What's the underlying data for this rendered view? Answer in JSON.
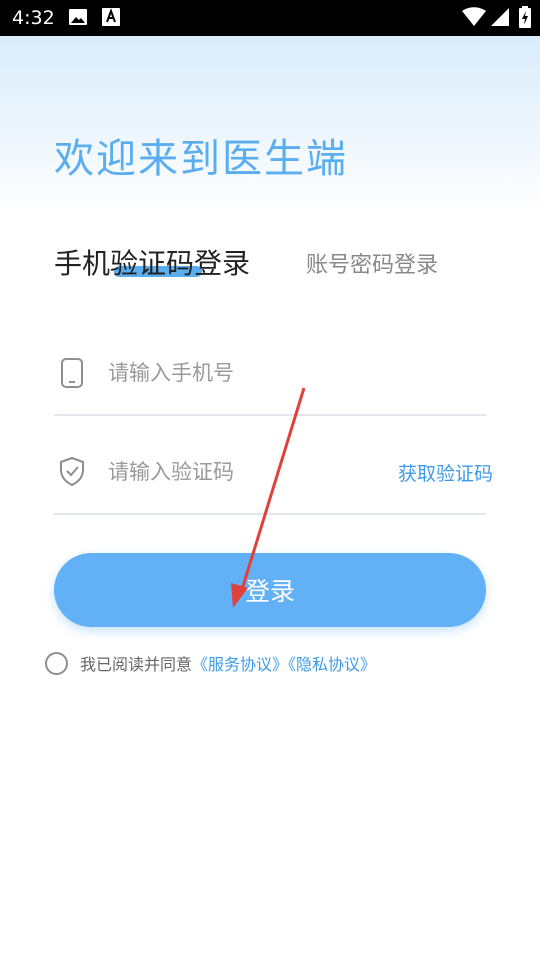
{
  "status_bar": {
    "time": "4:32",
    "icons": [
      "image-icon",
      "font-download-icon",
      "wifi-icon",
      "signal-icon",
      "battery-charging-icon"
    ]
  },
  "welcome_title": "欢迎来到医生端",
  "tabs": {
    "active_label": "手机验证码登录",
    "inactive_label": "账号密码登录"
  },
  "phone_field": {
    "placeholder": "请输入手机号",
    "value": ""
  },
  "code_field": {
    "placeholder": "请输入验证码",
    "value": ""
  },
  "get_code_label": "获取验证码",
  "login_button_label": "登录",
  "agreement": {
    "prefix": "我已阅读并同意",
    "service_link": "《服务协议》",
    "privacy_link": "《隐私协议》",
    "checked": false
  },
  "colors": {
    "accent": "#5aaef0",
    "button": "#62b0f5",
    "link": "#3f9be8",
    "annotation_arrow": "#e0413a"
  }
}
